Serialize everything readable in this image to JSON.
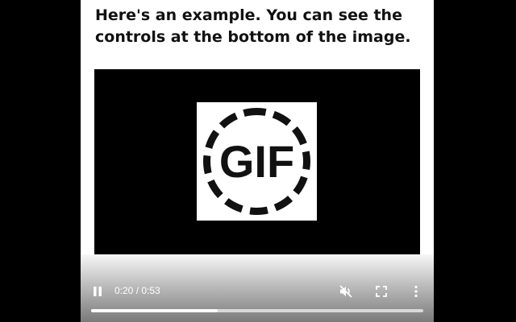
{
  "caption": {
    "text": "Here's an example. You can see the controls at the bottom of the image."
  },
  "video": {
    "logo_text": "GIF",
    "player": {
      "state": "playing",
      "current_time": "0:20",
      "duration": "0:53",
      "time_display": "0:20 / 0:53",
      "progress_fraction": 0.38,
      "muted": true,
      "icons": {
        "pause": "pause-icon",
        "mute": "volume-muted-icon",
        "fullscreen": "fullscreen-icon",
        "more": "more-vertical-icon"
      }
    }
  },
  "colors": {
    "page_background": "#000000",
    "content_background": "#ffffff",
    "video_background": "#000000",
    "control_icons": "#ffffff"
  }
}
